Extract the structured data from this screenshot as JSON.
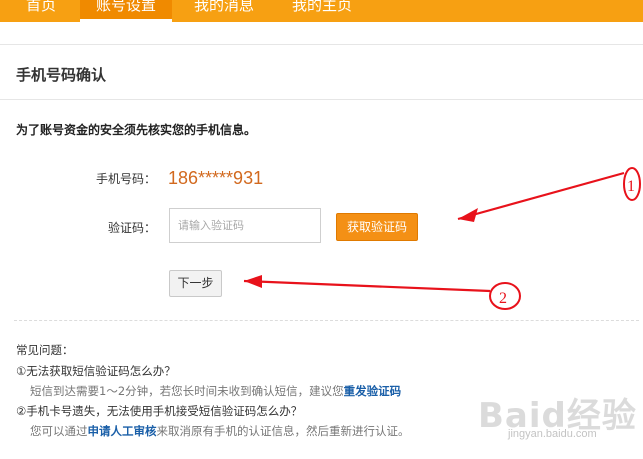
{
  "nav": {
    "tabs": [
      {
        "label": "首页"
      },
      {
        "label": "账号设置",
        "active": true
      },
      {
        "label": "我的消息"
      },
      {
        "label": "我的主页"
      }
    ]
  },
  "section": {
    "title": "手机号码确认",
    "notice": "为了账号资金的安全须先核实您的手机信息。"
  },
  "form": {
    "phone_label": "手机号码：",
    "phone_value": "186*****931",
    "code_label": "验证码：",
    "code_placeholder": "请输入验证码",
    "code_value": "",
    "get_code_button": "获取验证码",
    "next_button": "下一步"
  },
  "faq": {
    "heading": "常见问题：",
    "q1": "①无法获取短信验证码怎么办？",
    "a1_text": "短信到达需要1～2分钟，若您长时间未收到确认短信，建议您",
    "a1_link": "重发验证码",
    "q2": "②手机卡号遗失，无法使用手机接受短信验证码怎么办？",
    "a2_prefix": "您可以通过",
    "a2_link": "申请人工审核",
    "a2_suffix": "来取消原有手机的认证信息，然后重新进行认证。"
  },
  "annotations": {
    "marker1": "1",
    "marker2": "2",
    "color": "#e8121b"
  },
  "watermark": {
    "brand": "Baid经验",
    "url": "jingyan.baidu.com"
  },
  "colors": {
    "nav_bg": "#f7a012",
    "accent_orange": "#f49015",
    "phone_text": "#d2691e",
    "link_blue": "#1a5fa8"
  }
}
